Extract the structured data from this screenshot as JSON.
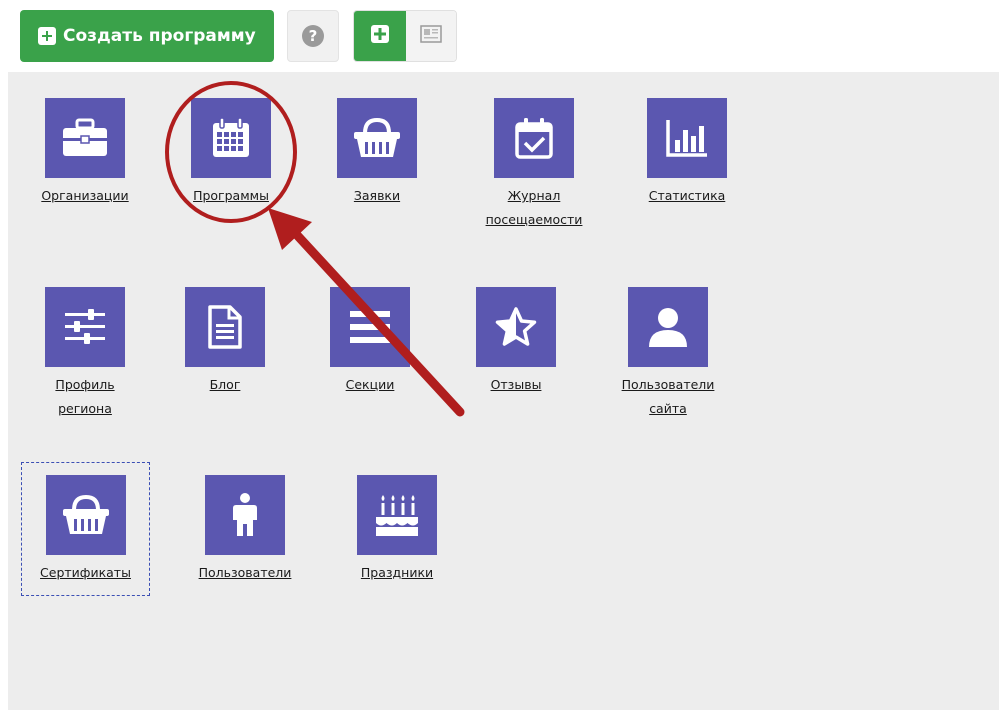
{
  "toolbar": {
    "create_label": "Создать программу",
    "help_glyph": "?"
  },
  "tiles": [
    {
      "id": "organizations",
      "label": "Организации",
      "icon": "briefcase-icon"
    },
    {
      "id": "programs",
      "label": "Программы",
      "icon": "calendar-icon"
    },
    {
      "id": "applications",
      "label": "Заявки",
      "icon": "basket-icon"
    },
    {
      "id": "attendance",
      "label": "Журнал посещаемости",
      "icon": "calendar-check-icon"
    },
    {
      "id": "statistics",
      "label": "Статистика",
      "icon": "bar-chart-icon"
    },
    {
      "id": "region-profile",
      "label": "Профиль региона",
      "icon": "sliders-icon"
    },
    {
      "id": "blog",
      "label": "Блог",
      "icon": "document-icon"
    },
    {
      "id": "sections",
      "label": "Секции",
      "icon": "list-icon"
    },
    {
      "id": "reviews",
      "label": "Отзывы",
      "icon": "star-icon"
    },
    {
      "id": "site-users",
      "label": "Пользователи сайта",
      "icon": "user-icon"
    },
    {
      "id": "certificates",
      "label": "Сертификаты",
      "icon": "basket-icon"
    },
    {
      "id": "users",
      "label": "Пользователи",
      "icon": "person-icon"
    },
    {
      "id": "holidays",
      "label": "Праздники",
      "icon": "cake-icon"
    }
  ],
  "colors": {
    "accent": "#3aa24a",
    "tile": "#5b57b0",
    "annotation": "#b01e1e",
    "panel": "#ededed"
  }
}
